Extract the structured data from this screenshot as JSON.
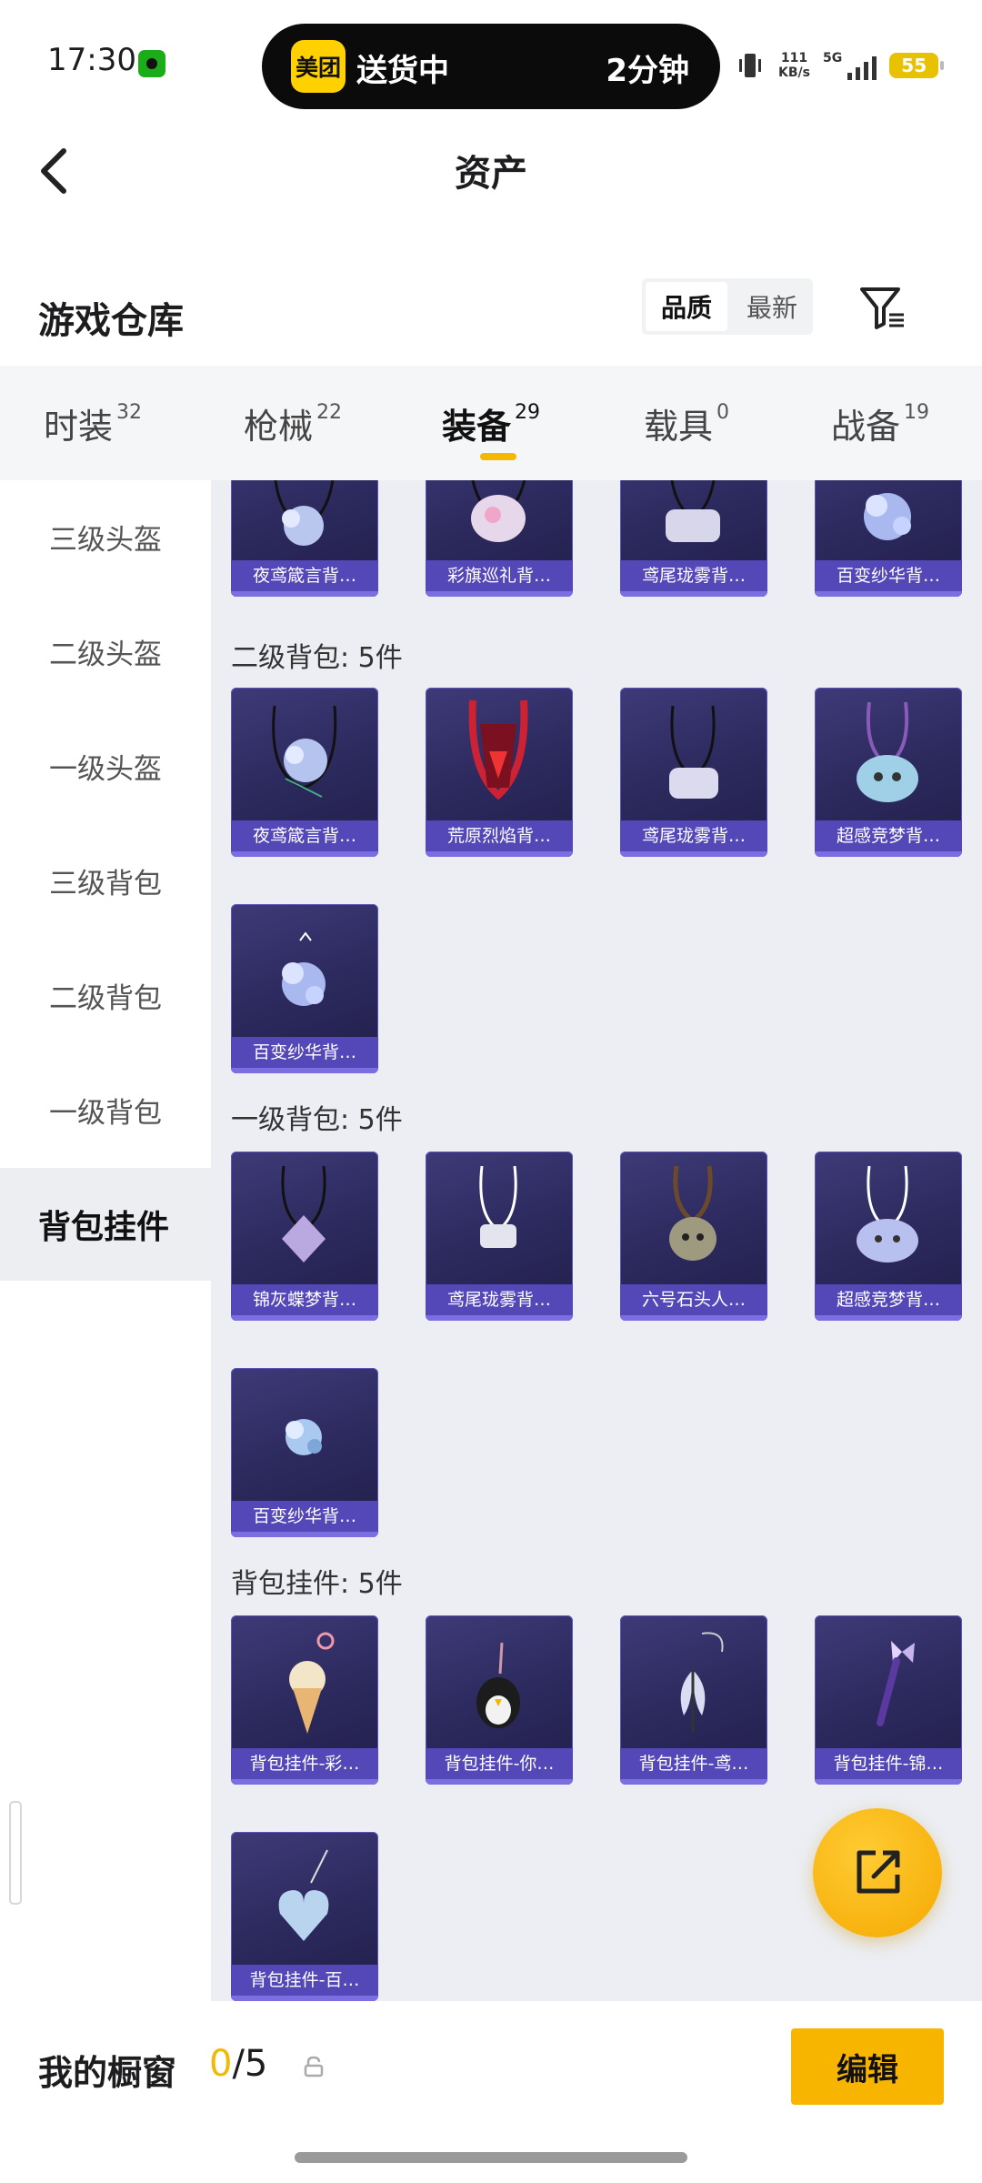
{
  "status_bar": {
    "time": "17:30",
    "island": {
      "app_badge": "美团",
      "text": "送货中",
      "eta": "2分钟"
    },
    "network_speed_value": "111",
    "network_speed_unit": "KB/s",
    "signal_label": "5G",
    "battery": "55"
  },
  "header": {
    "title": "资产"
  },
  "section": {
    "title": "游戏仓库",
    "sort_options": [
      "品质",
      "最新"
    ],
    "active_sort": "品质"
  },
  "tabs": [
    {
      "label": "时装",
      "count": "32"
    },
    {
      "label": "枪械",
      "count": "22"
    },
    {
      "label": "装备",
      "count": "29",
      "active": true
    },
    {
      "label": "载具",
      "count": "0"
    },
    {
      "label": "战备",
      "count": "19"
    }
  ],
  "sidebar": {
    "items": [
      "三级头盔",
      "二级头盔",
      "一级头盔",
      "三级背包",
      "二级背包",
      "一级背包",
      "背包挂件"
    ],
    "active": "背包挂件"
  },
  "content": {
    "top_row": [
      "夜鸢箴言背…",
      "彩旗巡礼背…",
      "鸢尾珑雾背…",
      "百变纱华背…"
    ],
    "groups": [
      {
        "label": "二级背包: 5件",
        "items": [
          "夜鸢箴言背…",
          "荒原烈焰背…",
          "鸢尾珑雾背…",
          "超感竞梦背…",
          "百变纱华背…"
        ]
      },
      {
        "label": "一级背包: 5件",
        "items": [
          "锦灰蝶梦背…",
          "鸢尾珑雾背…",
          "六号石头人…",
          "超感竞梦背…",
          "百变纱华背…"
        ]
      },
      {
        "label": "背包挂件: 5件",
        "items": [
          "背包挂件-彩…",
          "背包挂件-你…",
          "背包挂件-鸢…",
          "背包挂件-锦…",
          "背包挂件-百…"
        ]
      }
    ]
  },
  "bottom_bar": {
    "label": "我的橱窗",
    "current": "0",
    "separator_total": "/5",
    "edit_label": "编辑"
  },
  "colors": {
    "accent": "#f5b800",
    "card_bg": "#2b285c",
    "card_label": "#5447b8"
  }
}
